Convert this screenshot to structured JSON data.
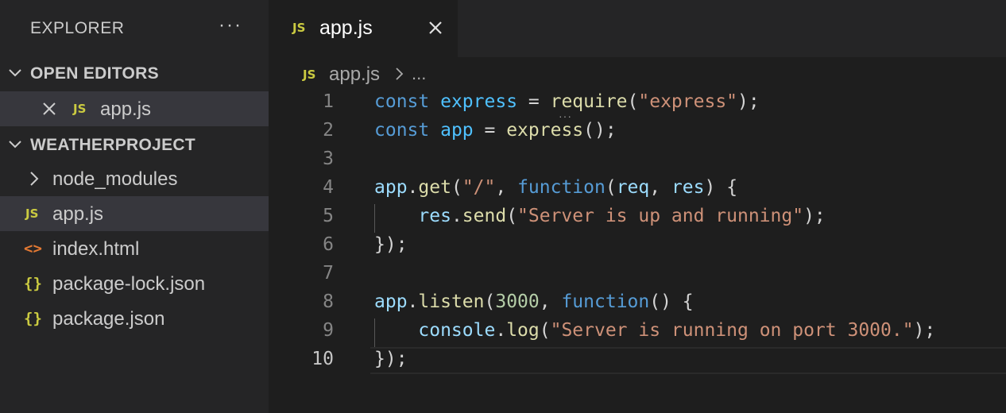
{
  "sidebar": {
    "title": "EXPLORER",
    "more_label": "···",
    "open_editors": {
      "title": "OPEN EDITORS",
      "items": [
        {
          "badge": "JS",
          "name": "app.js"
        }
      ]
    },
    "project": {
      "title": "WEATHERPROJECT",
      "items": [
        {
          "icon": "chevron-right-icon",
          "name": "node_modules",
          "type": "folder"
        },
        {
          "icon": "js-file-icon",
          "badge": "JS",
          "name": "app.js",
          "type": "file",
          "selected": true
        },
        {
          "icon": "html-file-icon",
          "badge": "<>",
          "name": "index.html",
          "type": "file"
        },
        {
          "icon": "json-file-icon",
          "badge": "{}",
          "name": "package-lock.json",
          "type": "file"
        },
        {
          "icon": "json-file-icon",
          "badge": "{}",
          "name": "package.json",
          "type": "file"
        }
      ]
    }
  },
  "tab": {
    "badge": "JS",
    "label": "app.js"
  },
  "breadcrumb": {
    "badge": "JS",
    "file": "app.js",
    "more": "..."
  },
  "editor": {
    "active_line": 10,
    "line_numbers": [
      "1",
      "2",
      "3",
      "4",
      "5",
      "6",
      "7",
      "8",
      "9",
      "10"
    ],
    "lines": [
      [
        {
          "t": "const",
          "c": "kw"
        },
        {
          "t": " "
        },
        {
          "t": "express",
          "c": "const"
        },
        {
          "t": " = "
        },
        {
          "t": "require",
          "c": "fn"
        },
        {
          "t": "("
        },
        {
          "t": "\"express\"",
          "c": "str"
        },
        {
          "t": ");"
        }
      ],
      [
        {
          "t": "const",
          "c": "kw"
        },
        {
          "t": " "
        },
        {
          "t": "app",
          "c": "const"
        },
        {
          "t": " = "
        },
        {
          "t": "express",
          "c": "fn"
        },
        {
          "t": "();"
        }
      ],
      [],
      [
        {
          "t": "app",
          "c": "var"
        },
        {
          "t": "."
        },
        {
          "t": "get",
          "c": "fn"
        },
        {
          "t": "("
        },
        {
          "t": "\"/\"",
          "c": "str"
        },
        {
          "t": ", "
        },
        {
          "t": "function",
          "c": "kw"
        },
        {
          "t": "("
        },
        {
          "t": "req",
          "c": "var"
        },
        {
          "t": ", "
        },
        {
          "t": "res",
          "c": "var"
        },
        {
          "t": ") {"
        }
      ],
      [
        {
          "t": "    "
        },
        {
          "t": "res",
          "c": "var"
        },
        {
          "t": "."
        },
        {
          "t": "send",
          "c": "fn"
        },
        {
          "t": "("
        },
        {
          "t": "\"Server is up and running\"",
          "c": "str"
        },
        {
          "t": ");"
        }
      ],
      [
        {
          "t": "});"
        }
      ],
      [],
      [
        {
          "t": "app",
          "c": "var"
        },
        {
          "t": "."
        },
        {
          "t": "listen",
          "c": "fn"
        },
        {
          "t": "("
        },
        {
          "t": "3000",
          "c": "num"
        },
        {
          "t": ", "
        },
        {
          "t": "function",
          "c": "kw"
        },
        {
          "t": "() {"
        }
      ],
      [
        {
          "t": "    "
        },
        {
          "t": "console",
          "c": "var"
        },
        {
          "t": "."
        },
        {
          "t": "log",
          "c": "fn"
        },
        {
          "t": "("
        },
        {
          "t": "\"Server is running on port 3000.\"",
          "c": "str"
        },
        {
          "t": ");"
        }
      ],
      [
        {
          "t": "});"
        }
      ]
    ]
  },
  "colors": {
    "js_badge": "#cbcb41",
    "html_icon": "#e37933",
    "json_icon": "#cbcb41",
    "keyword": "#569cd6",
    "string": "#ce9178",
    "function": "#dcdcaa",
    "number": "#b5cea8"
  }
}
